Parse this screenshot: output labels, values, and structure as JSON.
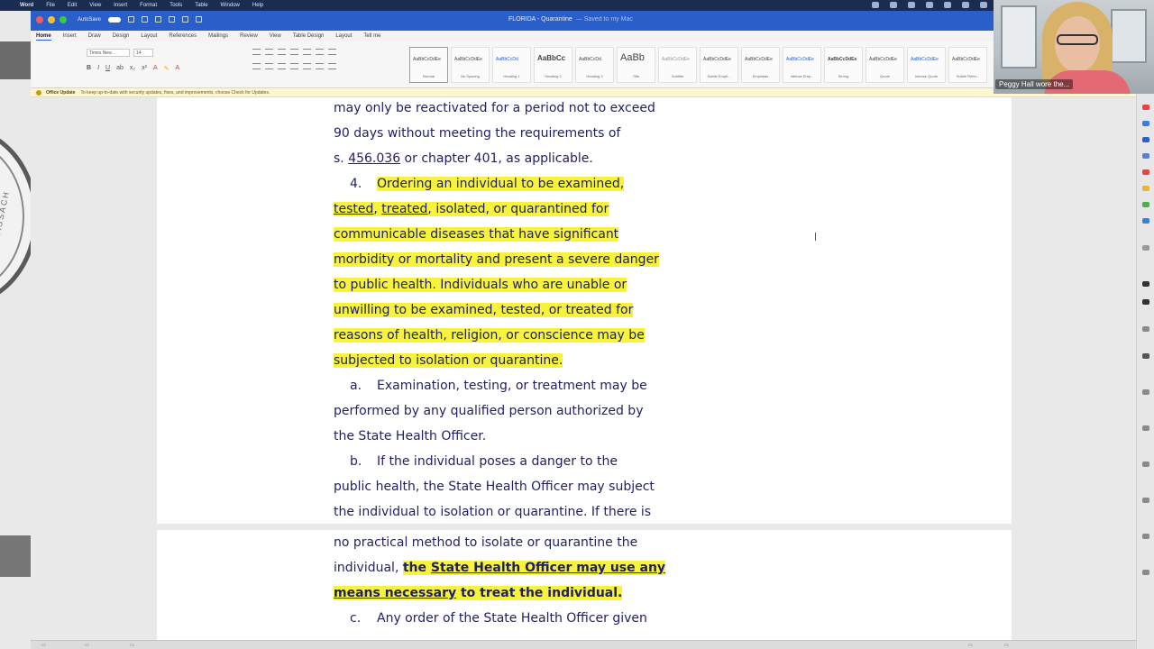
{
  "menubar": {
    "app": "Word",
    "items": [
      "File",
      "Edit",
      "View",
      "Insert",
      "Format",
      "Tools",
      "Table",
      "Window",
      "Help"
    ]
  },
  "titlebar": {
    "autosave_label": "AutoSave",
    "document_title": "FLORIDA - Quarantine",
    "document_status": "— Saved to my Mac"
  },
  "ribbon": {
    "tabs": [
      "Home",
      "Insert",
      "Draw",
      "Design",
      "Layout",
      "References",
      "Mailings",
      "Review",
      "View",
      "Table Design",
      "Layout",
      "Tell me"
    ],
    "font_name": "Times New…",
    "font_size": "14",
    "styles": [
      {
        "sample": "AaBbCcDdEe",
        "name": "Normal"
      },
      {
        "sample": "AaBbCcDdEe",
        "name": "No Spacing"
      },
      {
        "sample": "AaBbCcDd",
        "name": "Heading 1"
      },
      {
        "sample": "AaBbCc",
        "name": "Heading 2"
      },
      {
        "sample": "AaBbCcDd",
        "name": "Heading 3"
      },
      {
        "sample": "AaBb",
        "name": "Title"
      },
      {
        "sample": "AaBbCcDdEe",
        "name": "Subtitle"
      },
      {
        "sample": "AaBbCcDdEe",
        "name": "Subtle Emph..."
      },
      {
        "sample": "AaBbCcDdEe",
        "name": "Emphasis"
      },
      {
        "sample": "AaBbCcDdEe",
        "name": "Intense Emp..."
      },
      {
        "sample": "AaBbCcDdEe",
        "name": "Strong"
      },
      {
        "sample": "AaBbCcDdEe",
        "name": "Quote"
      },
      {
        "sample": "AaBbCcDdEe",
        "name": "Intense Quote"
      },
      {
        "sample": "AaBbCcDdEe",
        "name": "Subtle Refer..."
      }
    ]
  },
  "infobar": {
    "label": "Office Update",
    "message": "To keep up-to-date with security updates, fixes, and improvements, choose Check for Updates."
  },
  "document": {
    "p1": {
      "l1": "may only be reactivated for a period not to exceed",
      "l2": "90 days without meeting the requirements of",
      "l3_a": "s. ",
      "l3_link": "456.036",
      "l3_b": " or chapter 401, as applicable.",
      "item4_num": "4.",
      "item4_l1": "Ordering an individual to be examined,",
      "item4_l2_tested": "tested",
      "item4_l2_sep": ", ",
      "item4_l2_treated": "treated",
      "item4_l2_rest": ", isolated, or quarantined for",
      "item4_l3": "communicable diseases that have significant",
      "item4_l4": "morbidity or mortality and present a severe danger",
      "item4_l5": "to public health. Individuals who are unable or",
      "item4_l6": "unwilling to be examined, tested, or treated for",
      "item4_l7": "reasons of health, religion, or conscience may be",
      "item4_l8": "subjected to isolation or quarantine.",
      "a_num": "a.",
      "a_l1": "Examination, testing, or treatment may be",
      "a_l2": "performed by any qualified person authorized by",
      "a_l3": "the State Health Officer.",
      "b_num": "b.",
      "b_l1": "If the individual poses a danger to the",
      "b_l2": "public health, the State Health Officer may subject",
      "b_l3": "the individual to isolation or quarantine. If there is"
    },
    "p2": {
      "l1": "no practical method to isolate or quarantine the",
      "l2_a": "individual, ",
      "l2_hl_a": "the ",
      "l2_hl_u": "State Health Officer may use any",
      "l3_u": "means necessary",
      "l3_rest": " to treat the individual.",
      "c_num": "c.",
      "c_l1": "Any order of the State Health Officer given"
    }
  },
  "webcam": {
    "name_label": "Peggy Hall wore the..."
  },
  "seal_text": "MASSACH",
  "colors": {
    "titlebar": "#2a5ec9",
    "highlight": "#f7f23c",
    "doc_text": "#1f1f66"
  }
}
